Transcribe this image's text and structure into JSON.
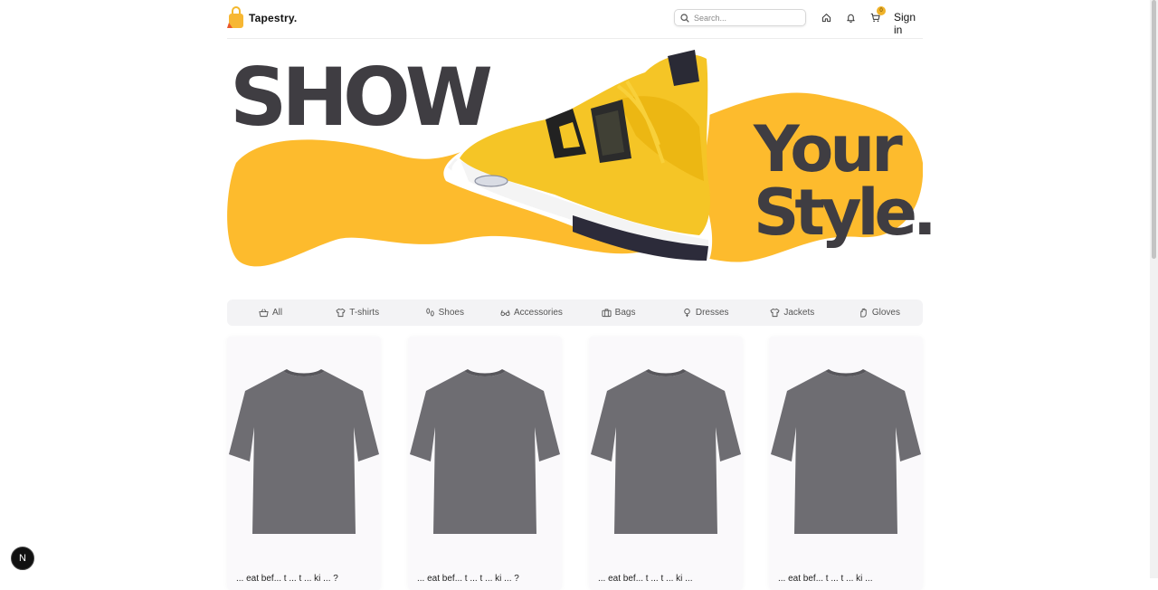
{
  "header": {
    "brand": "Tapestry.",
    "search_placeholder": "Search...",
    "cart_count": "0",
    "signin_label": "Sign in",
    "icons": [
      "home-icon",
      "bell-icon",
      "cart-icon"
    ]
  },
  "hero": {
    "line1": "SHOW",
    "line2": "Your",
    "line3": "Style.",
    "accent_color": "#FDBB2D",
    "text_color": "#3F3D42"
  },
  "categories": [
    {
      "label": "All",
      "icon": "basket-icon"
    },
    {
      "label": "T-shirts",
      "icon": "tshirt-icon"
    },
    {
      "label": "Shoes",
      "icon": "footprints-icon"
    },
    {
      "label": "Accessories",
      "icon": "glasses-icon"
    },
    {
      "label": "Bags",
      "icon": "briefcase-icon"
    },
    {
      "label": "Dresses",
      "icon": "dress-icon"
    },
    {
      "label": "Jackets",
      "icon": "jacket-icon"
    },
    {
      "label": "Gloves",
      "icon": "glove-icon"
    }
  ],
  "products": [
    {
      "title": "... eat bef... t ... t ... ki ... ?",
      "image": "grey-tshirt"
    },
    {
      "title": "... eat bef... t ... t ... ki ... ?",
      "image": "grey-tshirt"
    },
    {
      "title": "... eat bef... t ... t ... ki ...",
      "image": "grey-tshirt"
    },
    {
      "title": "... eat bef... t ... t ... ki ...",
      "image": "grey-tshirt"
    }
  ],
  "floating_badge": "N"
}
